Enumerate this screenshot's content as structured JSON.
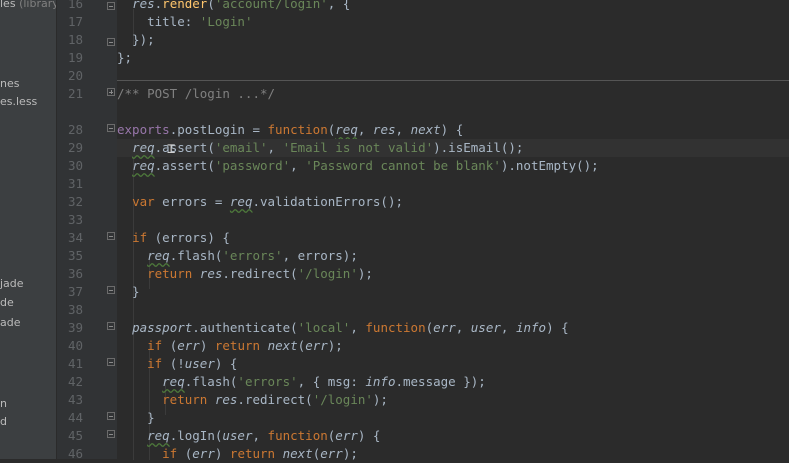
{
  "sidebar": {
    "items": [
      {
        "label": "les",
        "dim": "(library"
      },
      {
        "label": "nes",
        "dim": ""
      },
      {
        "label": "es.less",
        "dim": ""
      },
      {
        "label": "jade",
        "dim": ""
      },
      {
        "label": "de",
        "dim": ""
      },
      {
        "label": "ade",
        "dim": ""
      },
      {
        "label": "n",
        "dim": ""
      },
      {
        "label": "d",
        "dim": ""
      }
    ]
  },
  "editor": {
    "line_numbers": [
      "16",
      "17",
      "18",
      "19",
      "20",
      "21",
      "28",
      "29",
      "30",
      "31",
      "32",
      "33",
      "34",
      "35",
      "36",
      "37",
      "38",
      "39",
      "40",
      "41",
      "42",
      "43",
      "44",
      "45",
      "46"
    ]
  }
}
